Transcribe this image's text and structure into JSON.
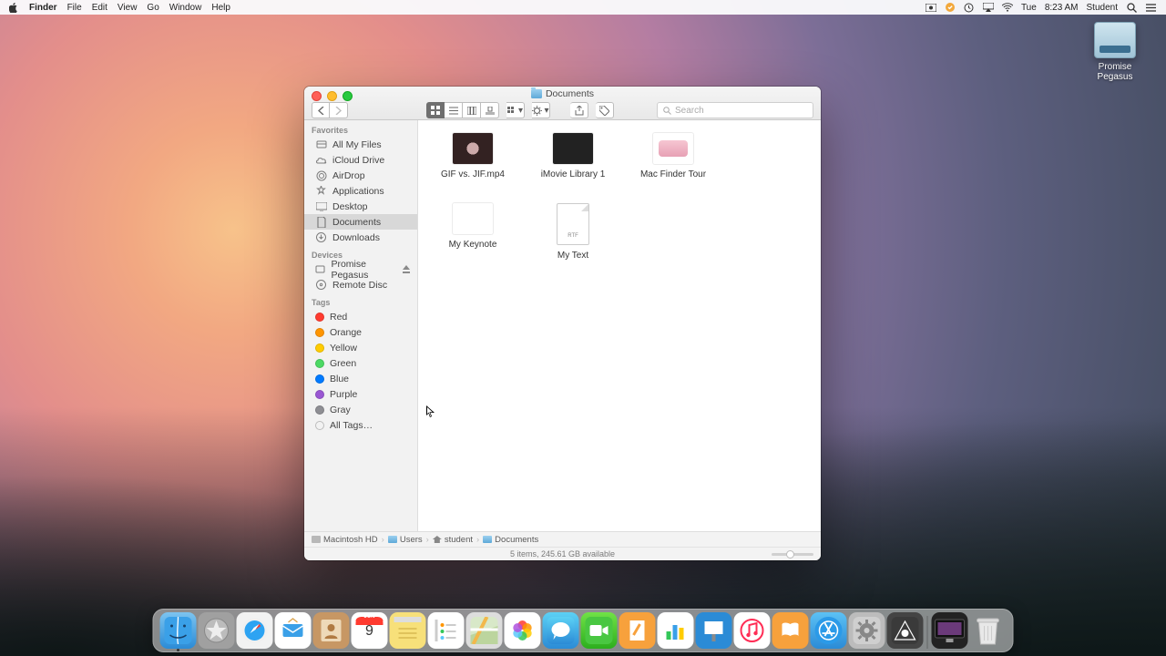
{
  "menubar": {
    "app": "Finder",
    "items": [
      "File",
      "Edit",
      "View",
      "Go",
      "Window",
      "Help"
    ],
    "right": {
      "day": "Tue",
      "time": "8:23 AM",
      "user": "Student"
    }
  },
  "desktop_icon": {
    "label": "Promise Pegasus"
  },
  "finder": {
    "title": "Documents",
    "search_placeholder": "Search",
    "sidebar": {
      "favorites": {
        "header": "Favorites",
        "items": [
          "All My Files",
          "iCloud Drive",
          "AirDrop",
          "Applications",
          "Desktop",
          "Documents",
          "Downloads"
        ],
        "selected": "Documents"
      },
      "devices": {
        "header": "Devices",
        "items": [
          "Promise Pegasus",
          "Remote Disc"
        ]
      },
      "tags": {
        "header": "Tags",
        "items": [
          {
            "label": "Red",
            "color": "#ff3b30"
          },
          {
            "label": "Orange",
            "color": "#ff9500"
          },
          {
            "label": "Yellow",
            "color": "#ffcc00"
          },
          {
            "label": "Green",
            "color": "#4cd964"
          },
          {
            "label": "Blue",
            "color": "#007aff"
          },
          {
            "label": "Purple",
            "color": "#9a57d3"
          },
          {
            "label": "Gray",
            "color": "#8e8e93"
          },
          {
            "label": "All Tags…",
            "color": null
          }
        ]
      }
    },
    "files": [
      {
        "name": "GIF vs. JIF.mp4",
        "kind": "video"
      },
      {
        "name": "iMovie Library 1",
        "kind": "imovie"
      },
      {
        "name": "Mac Finder Tour",
        "kind": "tour"
      },
      {
        "name": "My Keynote",
        "kind": "keynote"
      },
      {
        "name": "My Text",
        "kind": "rtf"
      }
    ],
    "path": [
      "Macintosh HD",
      "Users",
      "student",
      "Documents"
    ],
    "status": "5 items, 245.61 GB available"
  },
  "dock": {
    "apps": [
      "Finder",
      "Launchpad",
      "Safari",
      "Mail",
      "Contacts",
      "Calendar",
      "Notes",
      "Reminders",
      "Maps",
      "Photos",
      "Messages",
      "FaceTime",
      "Pages",
      "Numbers",
      "Keynote",
      "iTunes",
      "iBooks",
      "App Store",
      "System Preferences",
      "iMovie"
    ],
    "right": [
      "Display",
      "Trash"
    ],
    "cal_month": "JUN",
    "cal_day": "9"
  }
}
